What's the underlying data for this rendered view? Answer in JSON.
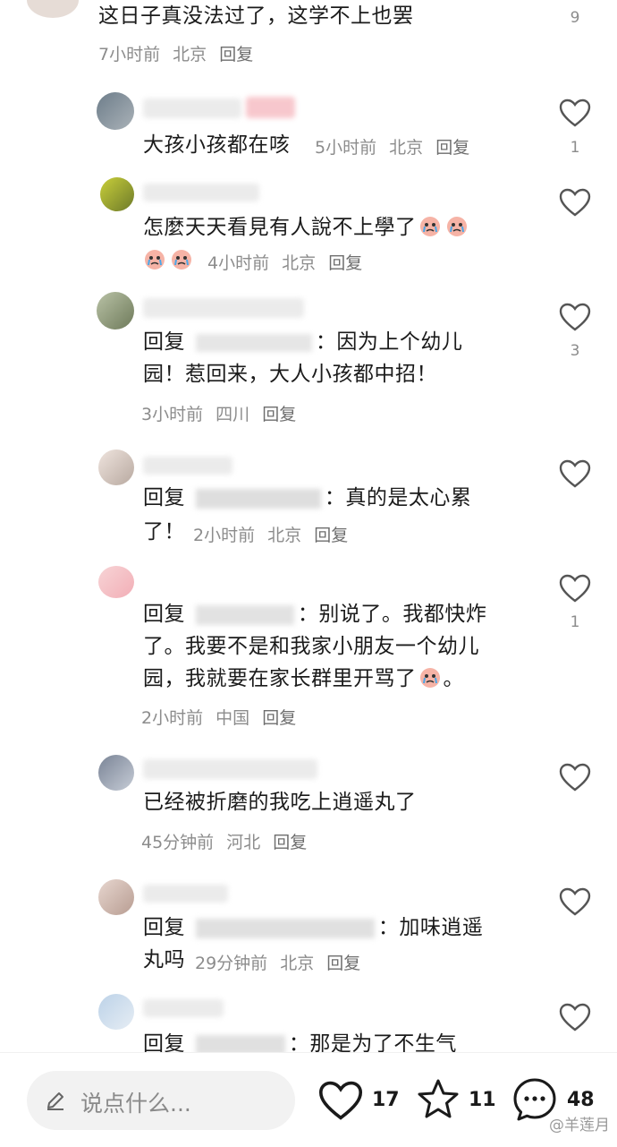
{
  "comments": [
    {
      "text": "这日子真没法过了，这学不上也罢",
      "time": "7小时前",
      "location": "北京",
      "reply_label": "回复",
      "likes": "9"
    },
    {
      "text": "大孩小孩都在咳",
      "time": "5小时前",
      "location": "北京",
      "reply_label": "回复",
      "likes": "1"
    },
    {
      "text": "怎麼天天看見有人說不上學了",
      "time": "4小时前",
      "location": "北京",
      "reply_label": "回复",
      "likes": ""
    },
    {
      "text_prefix": "回复",
      "text_line1_body": "因为上个幼儿",
      "text_line2": "园！惹回来，大人小孩都中招！",
      "time": "3小时前",
      "location": "四川",
      "reply_label": "回复",
      "likes": "3"
    },
    {
      "text_prefix": "回复",
      "text_line1_body": "真的是太心累",
      "text_line2": "了！",
      "time": "2小时前",
      "location": "北京",
      "reply_label": "回复",
      "likes": ""
    },
    {
      "text_prefix": "回复",
      "text_line1_body": "别说了。我都快炸",
      "text_line2": "了。我要不是和我家小朋友一个幼儿",
      "text_line3": "园，我就要在家长群里开骂了",
      "text_line3_tail": "。",
      "time": "2小时前",
      "location": "中国",
      "reply_label": "回复",
      "likes": "1"
    },
    {
      "text": "已经被折磨的我吃上逍遥丸了",
      "time": "45分钟前",
      "location": "河北",
      "reply_label": "回复",
      "likes": ""
    },
    {
      "text_prefix": "回复",
      "text_line1_body": "加味逍遥",
      "text_line2": "丸吗",
      "time": "29分钟前",
      "location": "北京",
      "reply_label": "回复",
      "likes": ""
    },
    {
      "text_prefix": "回复",
      "text_line1_body": "那是为了不生气",
      "likes": ""
    }
  ],
  "bottom_bar": {
    "placeholder": "说点什么...",
    "like_count": "17",
    "favorite_count": "11",
    "comment_count": "48"
  },
  "watermark": "@羊莲月",
  "colors": {
    "muted": "#8c8c8c",
    "text": "#1b1b1b",
    "pill": "#f2f2f2"
  }
}
